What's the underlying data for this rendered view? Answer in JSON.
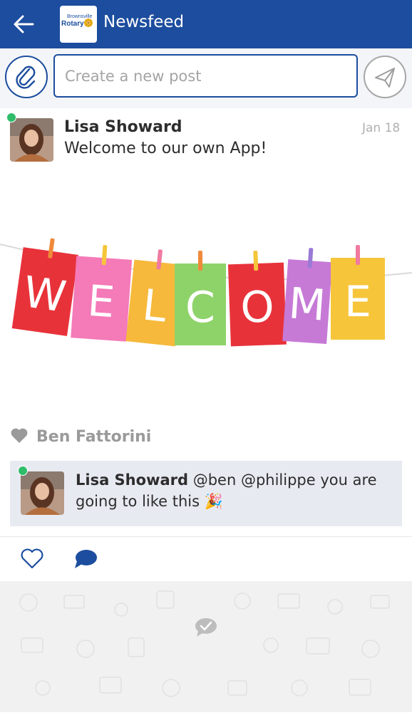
{
  "header": {
    "title": "Newsfeed",
    "logo_small": "Brownsville",
    "logo_main": "Rotary"
  },
  "composer": {
    "placeholder": "Create a new post"
  },
  "post": {
    "author": "Lisa Showard",
    "date": "Jan 18",
    "text": "Welcome to our own App!",
    "banner_letters": [
      "W",
      "E",
      "L",
      "C",
      "O",
      "M",
      "E"
    ]
  },
  "likes": {
    "name": "Ben Fattorini"
  },
  "comment": {
    "author": "Lisa Showard",
    "text": "@ben @philippe you are going to like this 🎉"
  },
  "colors": {
    "brand": "#1c4d9e",
    "online": "#2fbd6a",
    "comment_bg": "#e8eaf2"
  }
}
